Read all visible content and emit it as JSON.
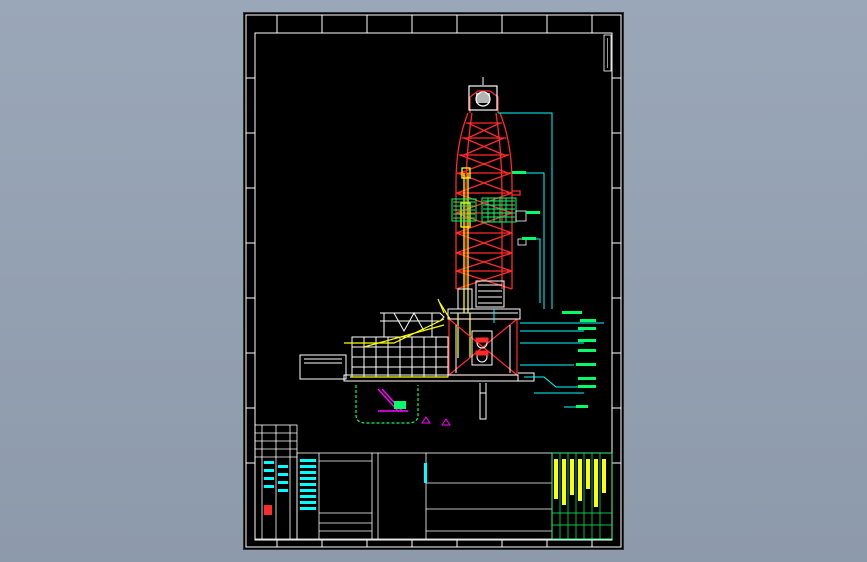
{
  "viewer": {
    "background_color": "#94a1b2",
    "sheet_color": "#000000"
  },
  "drawing": {
    "line_colors": {
      "frame": "#ffffff",
      "derrick": "#ff2a2a",
      "equipment": "#ffff00",
      "callouts": "#00ffff",
      "accent": "#ff00ff",
      "green": "#00ff66"
    },
    "title_block_rows": 6
  }
}
